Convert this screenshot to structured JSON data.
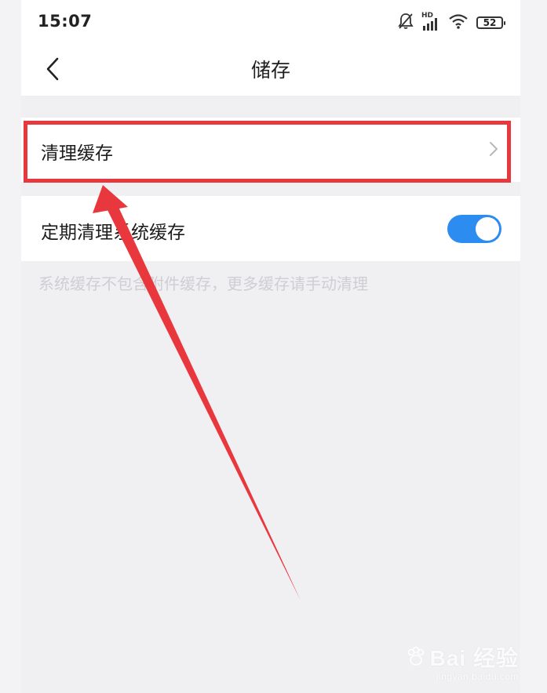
{
  "status_bar": {
    "time": "15:07",
    "battery": "52",
    "network": "HD",
    "icons": [
      "mute-bell-icon",
      "signal-icon",
      "wifi-icon",
      "battery-icon"
    ]
  },
  "nav": {
    "back_icon": "chevron-left-icon",
    "title": "储存"
  },
  "settings": {
    "clear_cache": {
      "label": "清理缓存",
      "icon": "chevron-right-icon"
    },
    "periodic_clear": {
      "label": "定期清理系统缓存",
      "enabled": true
    },
    "hint": "系统缓存不包含附件缓存，更多缓存请手动清理"
  },
  "annotation": {
    "box_color": "#e8383d",
    "arrow_color": "#e8383d"
  },
  "watermark": {
    "logo": "Bai 经验",
    "url": "jingyan.baidu.com"
  },
  "colors": {
    "toggle_on": "#2d8cf0",
    "background": "#f0f0f3"
  }
}
